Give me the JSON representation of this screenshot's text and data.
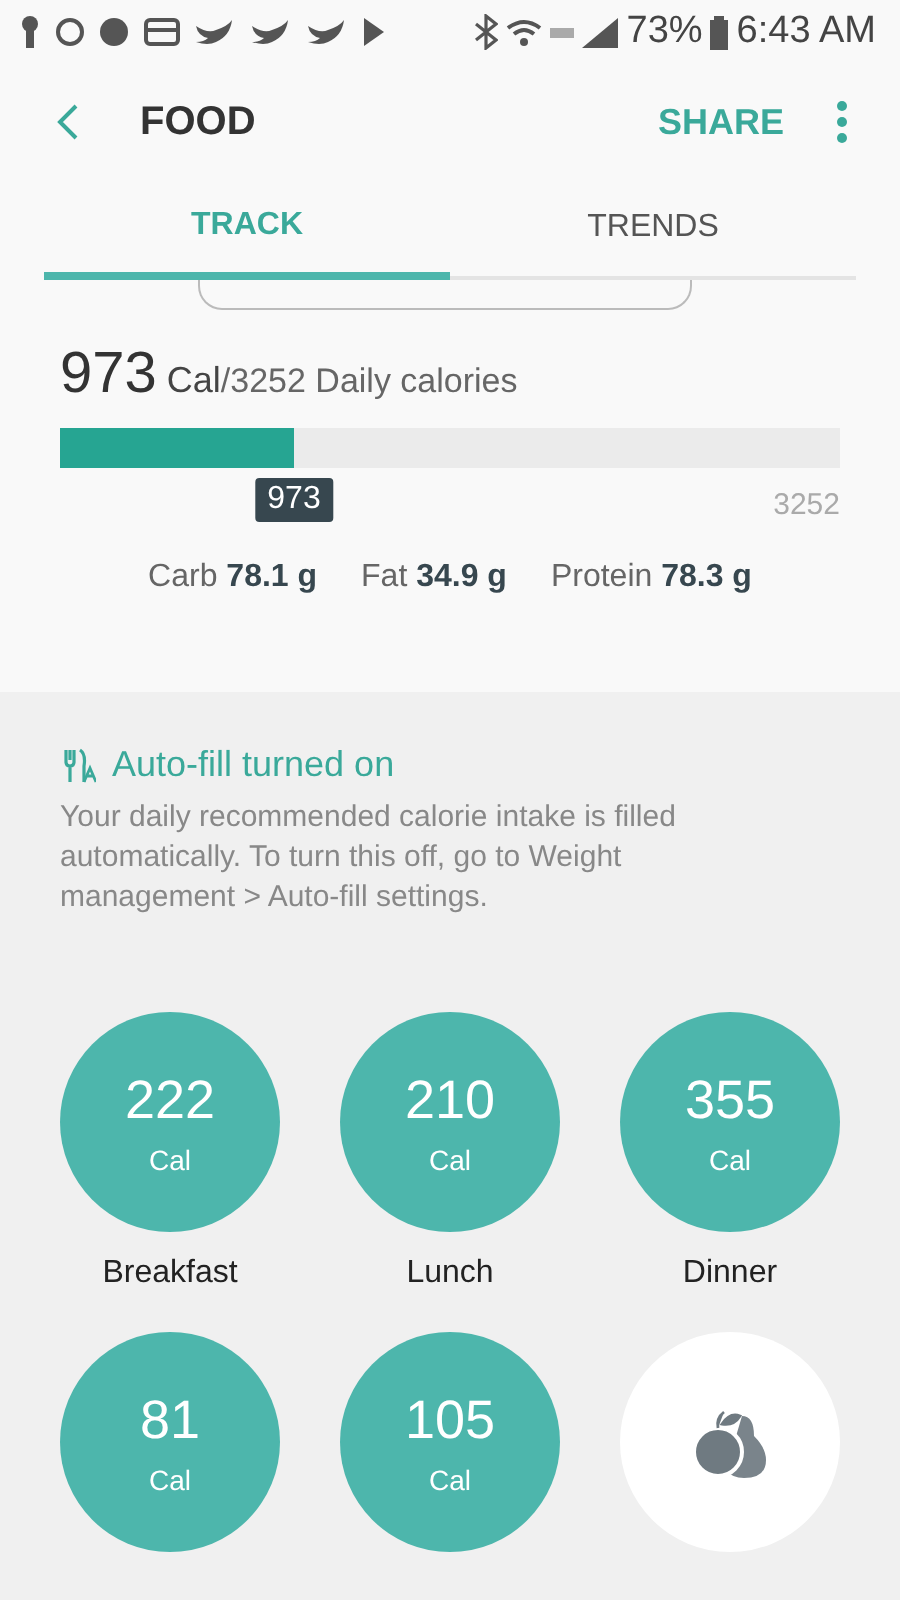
{
  "status_bar": {
    "battery": "73%",
    "time": "6:43 AM"
  },
  "header": {
    "title": "FOOD",
    "action": "SHARE"
  },
  "tabs": [
    {
      "label": "TRACK",
      "selected": true
    },
    {
      "label": "TRENDS",
      "selected": false
    }
  ],
  "calories": {
    "value": "973",
    "unit": "Cal",
    "goal_text": "/3252 Daily calories",
    "level": 0.3,
    "marker": "973",
    "max": "3252"
  },
  "nutrients": [
    {
      "label": "Carb",
      "value": "78.1 g"
    },
    {
      "label": "Fat",
      "value": "34.9 g"
    },
    {
      "label": "Protein",
      "value": "78.3 g"
    }
  ],
  "autofill": {
    "title": "Auto-fill turned on",
    "text": "Your daily recommended calorie intake is filled automatically. To turn this off, go to Weight management > Auto-fill settings."
  },
  "meals": [
    {
      "kind": "logged",
      "value": "222",
      "unit": "Cal",
      "label": "Breakfast"
    },
    {
      "kind": "logged",
      "value": "210",
      "unit": "Cal",
      "label": "Lunch"
    },
    {
      "kind": "logged",
      "value": "355",
      "unit": "Cal",
      "label": "Dinner"
    },
    {
      "kind": "logged",
      "value": "81",
      "unit": "Cal"
    },
    {
      "kind": "logged",
      "value": "105",
      "unit": "Cal"
    },
    {
      "kind": "add"
    }
  ]
}
